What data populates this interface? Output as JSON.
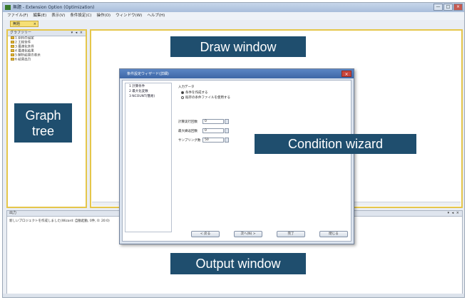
{
  "window": {
    "title": "無題 - Extension Option (Optimization)",
    "controls": [
      "—",
      "□",
      "×"
    ]
  },
  "menubar": [
    "ファイル(F)",
    "編集(E)",
    "表示(V)",
    "条件設定(C)",
    "操作(O)",
    "ウィンドウ(W)",
    "ヘルプ(H)"
  ],
  "doc_tab": {
    "label": "無題",
    "close": "×"
  },
  "graph_tree": {
    "header": "グラフツリー",
    "pin": "▾ ◂ ×",
    "items": [
      "1 原料の設定",
      "2 工程条件",
      "3 最適化条件",
      "4 最適化結果",
      "5 解析結果の表示",
      "6 結果出力"
    ]
  },
  "output": {
    "header": "出力",
    "pin": "▾ ◂ ×",
    "line": "新しいプロジェクトを作成しました(Wizard: 自動起動, 0件, 0: 20:0)"
  },
  "dialog": {
    "title": "条件設定ウィザード(詳細)",
    "close": "×",
    "steps": [
      "1 計算条件",
      "2 最大化変数",
      "3 NCOUNT(簡易)"
    ],
    "section": "入力データ",
    "radio_1": "条件を作成する",
    "radio_2": "既存の条件ファイルを使用する",
    "fields": [
      {
        "label": "計算実行回数",
        "value": "0"
      },
      {
        "label": "最大繰返回数",
        "value": "0"
      },
      {
        "label": "サンプリング数",
        "value": "50"
      }
    ],
    "buttons": [
      "< 戻る",
      "次へ(N) >",
      "完了",
      "閉じる"
    ]
  },
  "callouts": {
    "draw": "Draw window",
    "graph_line1": "Graph",
    "graph_line2": "tree",
    "wizard": "Condition wizard",
    "output": "Output window"
  },
  "colors": {
    "callout_bg": "#1f4e6e",
    "pane_highlight": "#e5c64a",
    "dialog_title": "#3d66a6"
  }
}
